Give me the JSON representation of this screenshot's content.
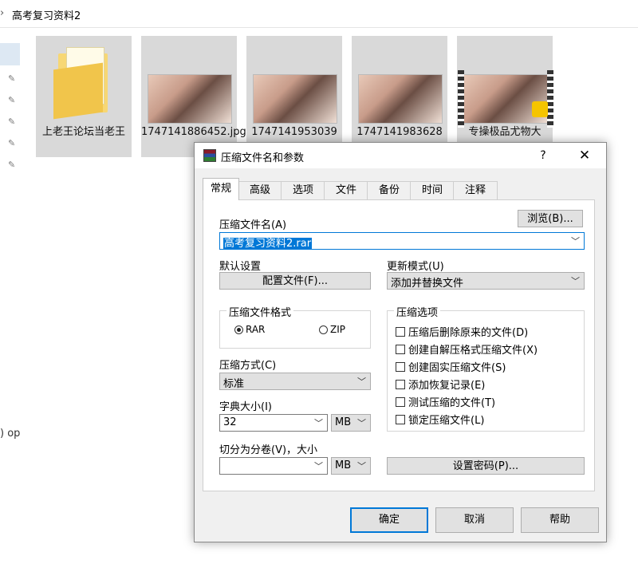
{
  "explorer": {
    "breadcrumb_chevron": "›",
    "breadcrumb": "高考复习资料2",
    "pins": [
      "✎",
      "✎",
      "✎",
      "✎",
      "✎"
    ],
    "left_text": ") op",
    "files": [
      {
        "name": "上老王论坛当老王",
        "type": "folder"
      },
      {
        "name": "1747141886452.jpg",
        "type": "image"
      },
      {
        "name": "1747141953039",
        "type": "image"
      },
      {
        "name": "1747141983628",
        "type": "image"
      },
      {
        "name": "专操极品尤物大",
        "type": "video"
      }
    ]
  },
  "dialog": {
    "title": "压缩文件名和参数",
    "help": "?",
    "close": "✕",
    "tabs": [
      "常规",
      "高级",
      "选项",
      "文件",
      "备份",
      "时间",
      "注释"
    ],
    "archive_name_label": "压缩文件名(A)",
    "browse_button": "浏览(B)...",
    "archive_name_value": "高考复习资料2.rar",
    "default_settings_label": "默认设置",
    "profiles_button": "配置文件(F)...",
    "update_mode_label": "更新模式(U)",
    "update_mode_value": "添加并替换文件",
    "format_group": "压缩文件格式",
    "format_rar": "RAR",
    "format_zip": "ZIP",
    "method_label": "压缩方式(C)",
    "method_value": "标准",
    "dict_label": "字典大小(I)",
    "dict_value": "32",
    "dict_unit": "MB",
    "split_label": "切分为分卷(V)，大小",
    "split_value": "",
    "split_unit": "MB",
    "options_group": "压缩选项",
    "options": [
      "压缩后删除原来的文件(D)",
      "创建自解压格式压缩文件(X)",
      "创建固实压缩文件(S)",
      "添加恢复记录(E)",
      "测试压缩的文件(T)",
      "锁定压缩文件(L)"
    ],
    "password_button": "设置密码(P)...",
    "ok_button": "确定",
    "cancel_button": "取消",
    "help_button": "帮助",
    "arrow": "﹀"
  }
}
